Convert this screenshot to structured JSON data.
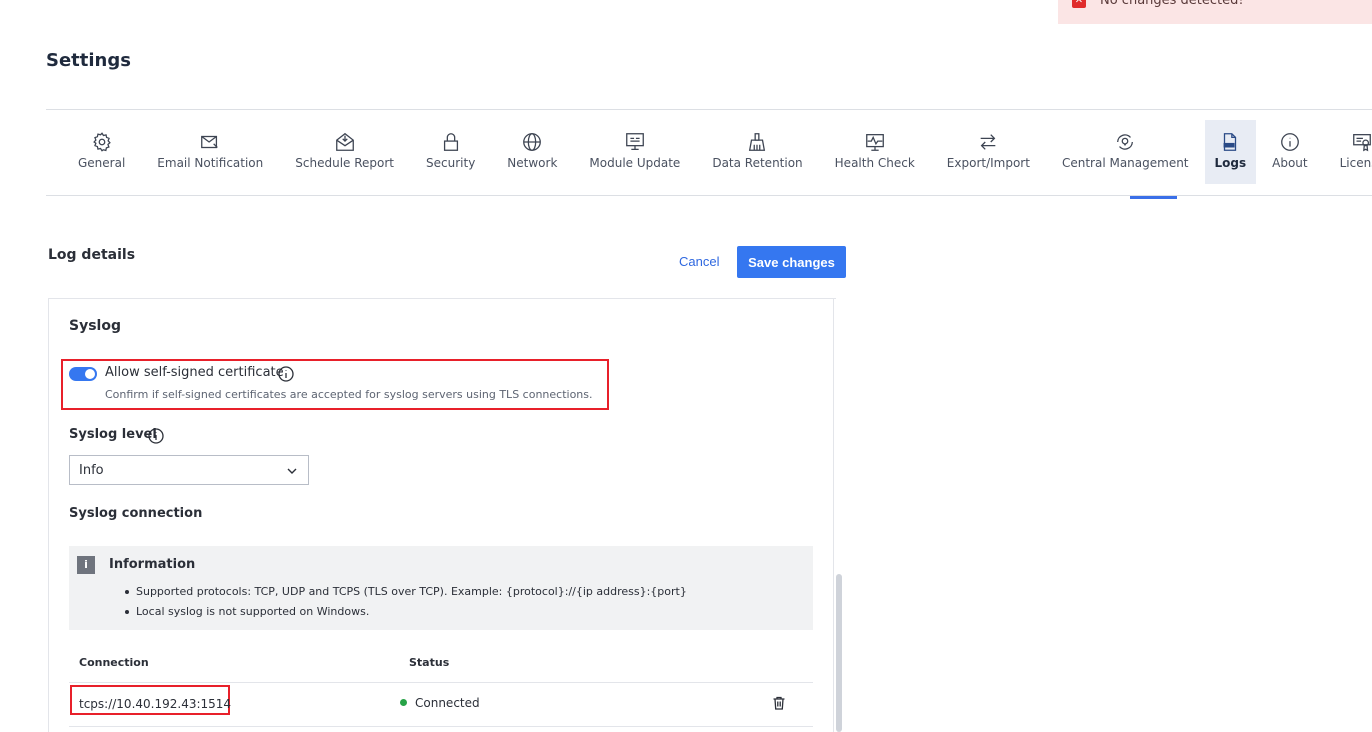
{
  "toast": {
    "message": "No changes detected!",
    "color": "#fbe5e5",
    "icon": "error-x-icon"
  },
  "page": {
    "title": "Settings"
  },
  "tabs": [
    {
      "label": "General",
      "icon": "gear-icon"
    },
    {
      "label": "Email Notification",
      "icon": "mail-icon"
    },
    {
      "label": "Schedule Report",
      "icon": "envelope-open-icon"
    },
    {
      "label": "Security",
      "icon": "lock-icon"
    },
    {
      "label": "Network",
      "icon": "globe-icon"
    },
    {
      "label": "Module Update",
      "icon": "monitor-icon"
    },
    {
      "label": "Data Retention",
      "icon": "broom-icon"
    },
    {
      "label": "Health Check",
      "icon": "pulse-monitor-icon"
    },
    {
      "label": "Export/Import",
      "icon": "arrows-swap-icon"
    },
    {
      "label": "Central Management",
      "icon": "bulb-cycle-icon"
    },
    {
      "label": "Logs",
      "icon": "log-file-icon",
      "active": true
    },
    {
      "label": "About",
      "icon": "info-icon"
    },
    {
      "label": "License",
      "icon": "certificate-icon"
    }
  ],
  "section": {
    "title": "Log details",
    "cancel_label": "Cancel",
    "save_label": "Save changes"
  },
  "syslog": {
    "title": "Syslog",
    "allow_self_signed": {
      "label": "Allow self-signed certificate",
      "enabled": true,
      "description": "Confirm if self-signed certificates are accepted for syslog servers using TLS connections."
    },
    "level": {
      "label": "Syslog level",
      "value": "Info"
    },
    "connection": {
      "label": "Syslog connection",
      "info": {
        "badge": "i",
        "title": "Information",
        "items": [
          "Supported protocols: TCP, UDP and TCPS (TLS over TCP). Example: {protocol}://{ip address}:{port}",
          "Local syslog is not supported on Windows."
        ]
      },
      "table": {
        "headers": [
          "Connection",
          "Status"
        ],
        "rows": [
          {
            "connection": "tcps://10.40.192.43:1514",
            "status": "Connected",
            "status_color": "#27a347"
          }
        ]
      }
    }
  },
  "colors": {
    "accent": "#3577f0",
    "highlight": "#e8202a"
  }
}
